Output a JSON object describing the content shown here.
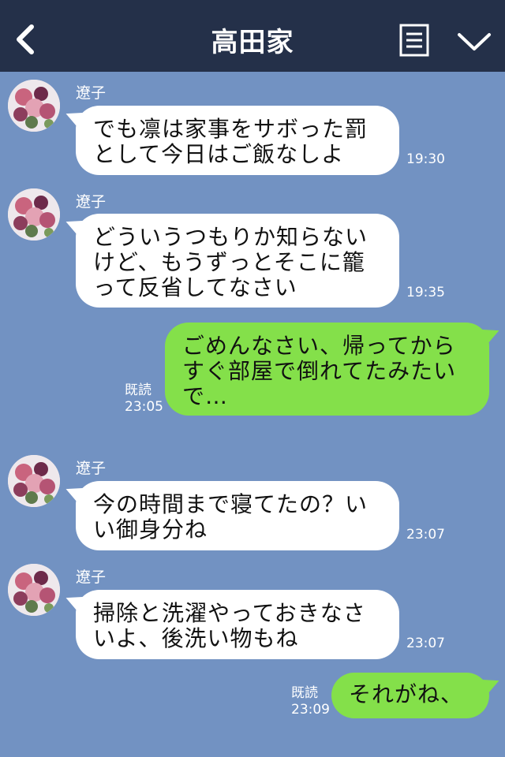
{
  "header": {
    "title": "高田家"
  },
  "messages": [
    {
      "sender": "遼子",
      "text": "でも凛は家事をサボった罰\nとして今日はご飯なしよ",
      "time": "19:30"
    },
    {
      "sender": "遼子",
      "text": "どういうつもりか知らない\nけど、もうずっとそこに籠\nって反省してなさい",
      "time": "19:35"
    },
    {
      "read": "既読",
      "time": "23:05",
      "text": "ごめんなさい、帰ってから\nすぐ部屋で倒れてたみたい\nで…"
    },
    {
      "sender": "遼子",
      "text": "今の時間まで寝てたの？い\nい御身分ね",
      "time": "23:07"
    },
    {
      "sender": "遼子",
      "text": "掃除と洗濯やっておきなさ\nいよ、後洗い物もね",
      "time": "23:07"
    },
    {
      "read": "既読",
      "time": "23:09",
      "text": "それがね、"
    }
  ]
}
